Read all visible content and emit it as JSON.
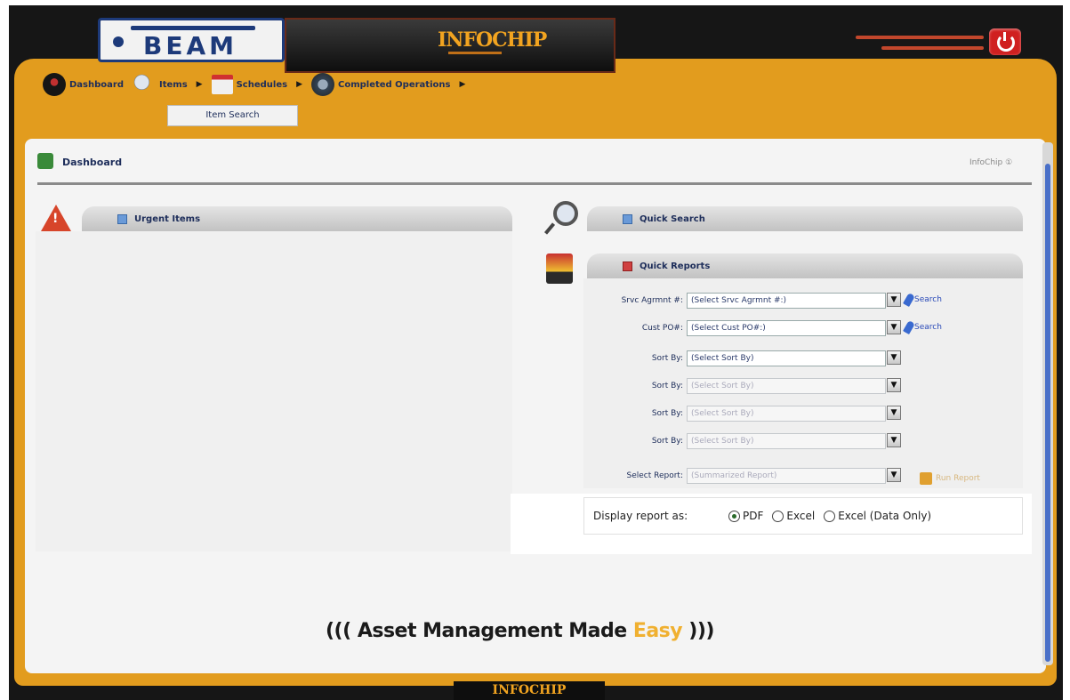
{
  "branding": {
    "beam": "BEAM",
    "infochip": "INFOCHIP",
    "footer": "INFOCHIP"
  },
  "colors": {
    "frame": "#161616",
    "orange": "#e29c1e",
    "nav_text": "#1d2d5a",
    "link": "#2a4ab8",
    "easy": "#f0b030"
  },
  "menu": {
    "items": [
      {
        "label": "Dashboard",
        "icon": "dashboard-icon",
        "arrow": false
      },
      {
        "label": "Items",
        "icon": "search-icon",
        "arrow": true
      },
      {
        "label": "Schedules",
        "icon": "calendar-icon",
        "arrow": true
      },
      {
        "label": "Completed Operations",
        "icon": "operations-icon",
        "arrow": true
      }
    ],
    "submenu": "Item Search"
  },
  "page": {
    "title": "Dashboard",
    "version": "InfoChip ①"
  },
  "urgent": {
    "title": "Urgent Items"
  },
  "quick_search": {
    "title": "Quick Search"
  },
  "quick_reports": {
    "title": "Quick Reports",
    "rows": [
      {
        "label": "Srvc Agrmnt #:",
        "value": "(Select Srvc Agrmnt #:)",
        "disabled": false,
        "link": "Search"
      },
      {
        "label": "Cust PO#:",
        "value": "(Select Cust PO#:)",
        "disabled": false,
        "link": "Search"
      },
      {
        "label": "Sort By:",
        "value": "(Select Sort By)",
        "disabled": false,
        "link": ""
      },
      {
        "label": "Sort By:",
        "value": "(Select Sort By)",
        "disabled": true,
        "link": ""
      },
      {
        "label": "Sort By:",
        "value": "(Select Sort By)",
        "disabled": true,
        "link": ""
      },
      {
        "label": "Sort By:",
        "value": "(Select Sort By)",
        "disabled": true,
        "link": ""
      },
      {
        "label": "Select Report:",
        "value": "(Summarized Report)",
        "disabled": true,
        "link": "",
        "run": "Run Report"
      }
    ]
  },
  "display_report": {
    "label": "Display report as:",
    "options": [
      {
        "label": "PDF",
        "checked": true
      },
      {
        "label": "Excel",
        "checked": false
      },
      {
        "label": "Excel (Data Only)",
        "checked": false
      }
    ]
  },
  "tagline": {
    "prefix": "((( ",
    "main": "Asset Management Made ",
    "easy": "Easy",
    "suffix": " )))"
  }
}
